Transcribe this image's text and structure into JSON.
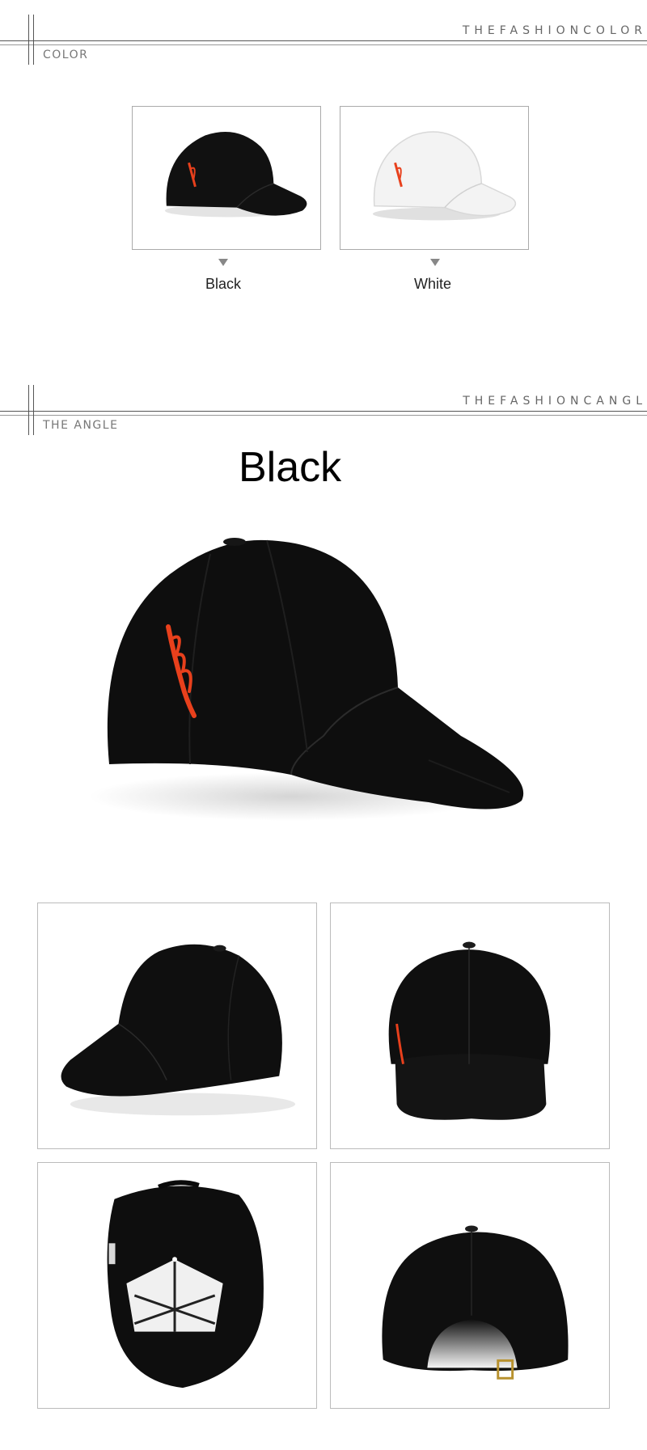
{
  "color_section": {
    "right_label": "THEFASHIONCOLOR",
    "left_label": "COLOR",
    "swatches": [
      {
        "label": "Black",
        "color": "#111111"
      },
      {
        "label": "White",
        "color": "#f2f2f2"
      }
    ]
  },
  "angle_section": {
    "right_label": "THEFASHIONCANGL",
    "left_label": "THE ANGLE",
    "title": "Black"
  },
  "colors": {
    "embroidery": "#e8401c",
    "cap_black": "#111111",
    "cap_white": "#f3f3f3",
    "line": "#555555"
  },
  "icons": {
    "swatch_arrow": "triangle-down-icon"
  },
  "views": [
    {
      "name": "side-front-view"
    },
    {
      "name": "front-view"
    },
    {
      "name": "underside-view"
    },
    {
      "name": "back-view"
    }
  ]
}
